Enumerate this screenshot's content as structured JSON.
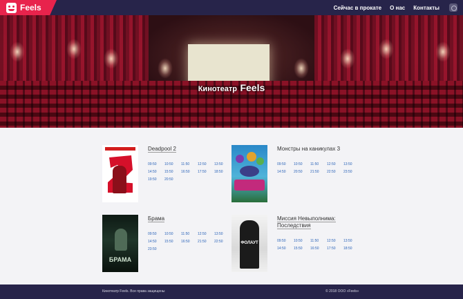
{
  "header": {
    "brand": "Feels",
    "nav": [
      "Сейчас в прокате",
      "О нас",
      "Контакты"
    ]
  },
  "hero": {
    "title_prefix": "Кинотеатр",
    "title_name": "Feels"
  },
  "movies": [
    {
      "title": "Deadpool 2",
      "poster_icon": "deadpool-poster",
      "times": [
        "09:50",
        "10:50",
        "11:50",
        "12:50",
        "13:50",
        "14:50",
        "15:50",
        "16:50",
        "17:50",
        "18:50",
        "19:50",
        "20:50"
      ]
    },
    {
      "title": "Монстры на каникулах 3",
      "poster_icon": "monsters-poster",
      "times": [
        "09:50",
        "10:50",
        "11:50",
        "12:50",
        "13:50",
        "14:50",
        "20:50",
        "21:50",
        "22:50",
        "23:50"
      ]
    },
    {
      "title": "Брама",
      "poster_icon": "brama-poster",
      "poster_text": "БРАМА",
      "times": [
        "09:50",
        "10:50",
        "11:50",
        "12:50",
        "13:50",
        "14:50",
        "15:50",
        "16:50",
        "21:50",
        "22:50",
        "23:50"
      ]
    },
    {
      "title": "Миссия Невыполнима: Последствия",
      "poster_icon": "mission-impossible-poster",
      "poster_text": "ФОЛАУТ",
      "times": [
        "09:50",
        "10:50",
        "11:50",
        "12:50",
        "13:50",
        "14:50",
        "15:50",
        "16:50",
        "17:50",
        "18:50"
      ]
    }
  ],
  "footer": {
    "left": "Кинотеатр Feels. Все права защищены",
    "right": "© 2018 ООО «Feels»"
  },
  "colors": {
    "header_bg": "#27244a",
    "brand_accent": "#e8234c",
    "time_link": "#2a63b8"
  }
}
